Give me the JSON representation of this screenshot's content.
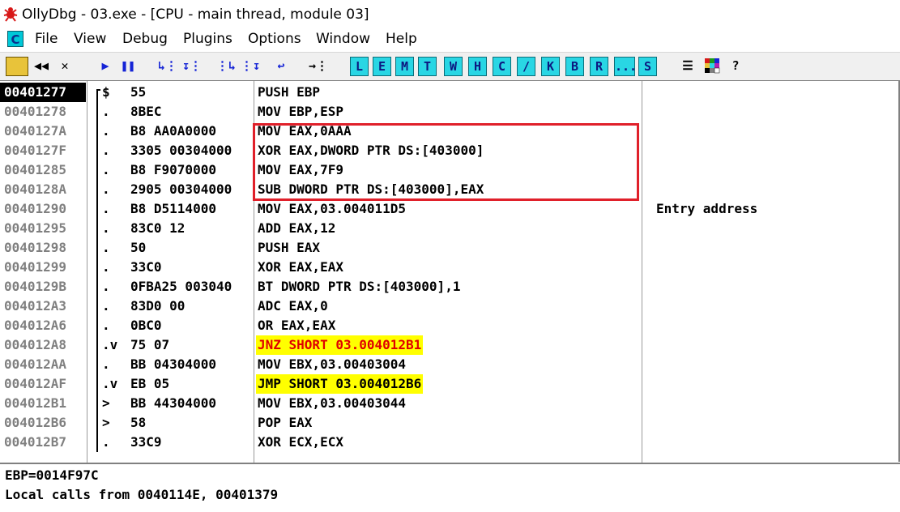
{
  "window": {
    "title": "OllyDbg - 03.exe - [CPU - main thread, module 03]"
  },
  "menu": {
    "sys_icon": "C",
    "items": [
      "File",
      "View",
      "Debug",
      "Plugins",
      "Options",
      "Window",
      "Help"
    ]
  },
  "toolbar": {
    "left_buttons": [
      "open-icon",
      "restart-icon",
      "close-icon",
      "run-icon",
      "pause-icon",
      "step-into-icon",
      "step-over-icon",
      "trace-into-icon",
      "trace-over-icon",
      "execute-till-return-icon",
      "go-to-icon"
    ],
    "letters": [
      "L",
      "E",
      "M",
      "T",
      "W",
      "H",
      "C",
      "/",
      "K",
      "B",
      "R",
      "...",
      "S"
    ],
    "right_buttons": [
      "list-icon",
      "colors-icon",
      "help-icon"
    ],
    "help_label": "?"
  },
  "disasm": {
    "rows": [
      {
        "addr": "00401277",
        "marker": "$",
        "hex": "55",
        "instr": "PUSH EBP",
        "comment": "",
        "current": true
      },
      {
        "addr": "00401278",
        "marker": ".",
        "hex": "8BEC",
        "instr": "MOV EBP,ESP",
        "comment": ""
      },
      {
        "addr": "0040127A",
        "marker": ".",
        "hex": "B8 AA0A0000",
        "instr": "MOV EAX,0AAA",
        "comment": ""
      },
      {
        "addr": "0040127F",
        "marker": ".",
        "hex": "3305 00304000",
        "instr": "XOR EAX,DWORD PTR DS:[403000]",
        "comment": ""
      },
      {
        "addr": "00401285",
        "marker": ".",
        "hex": "B8 F9070000",
        "instr": "MOV EAX,7F9",
        "comment": ""
      },
      {
        "addr": "0040128A",
        "marker": ".",
        "hex": "2905 00304000",
        "instr": "SUB DWORD PTR DS:[403000],EAX",
        "comment": ""
      },
      {
        "addr": "00401290",
        "marker": ".",
        "hex": "B8 D5114000",
        "instr": "MOV EAX,03.004011D5",
        "comment": "Entry address"
      },
      {
        "addr": "00401295",
        "marker": ".",
        "hex": "83C0 12",
        "instr": "ADD EAX,12",
        "comment": ""
      },
      {
        "addr": "00401298",
        "marker": ".",
        "hex": "50",
        "instr": "PUSH EAX",
        "comment": ""
      },
      {
        "addr": "00401299",
        "marker": ".",
        "hex": "33C0",
        "instr": "XOR EAX,EAX",
        "comment": ""
      },
      {
        "addr": "0040129B",
        "marker": ".",
        "hex": "0FBA25 003040",
        "instr": "BT DWORD PTR DS:[403000],1",
        "comment": ""
      },
      {
        "addr": "004012A3",
        "marker": ".",
        "hex": "83D0 00",
        "instr": "ADC EAX,0",
        "comment": ""
      },
      {
        "addr": "004012A6",
        "marker": ".",
        "hex": "0BC0",
        "instr": "OR EAX,EAX",
        "comment": ""
      },
      {
        "addr": "004012A8",
        "marker": ".v",
        "hex": "75 07",
        "instr": "JNZ SHORT 03.004012B1",
        "comment": "",
        "style": "jnz"
      },
      {
        "addr": "004012AA",
        "marker": ".",
        "hex": "BB 04304000",
        "instr": "MOV EBX,03.00403004",
        "comment": ""
      },
      {
        "addr": "004012AF",
        "marker": ".v",
        "hex": "EB 05",
        "instr": "JMP SHORT 03.004012B6",
        "comment": "",
        "style": "jmp"
      },
      {
        "addr": "004012B1",
        "marker": ">",
        "hex": "BB 44304000",
        "instr": "MOV EBX,03.00403044",
        "comment": ""
      },
      {
        "addr": "004012B6",
        "marker": ">",
        "hex": "58",
        "instr": "POP EAX",
        "comment": ""
      },
      {
        "addr": "004012B7",
        "marker": ".",
        "hex": "33C9",
        "instr": "XOR ECX,ECX",
        "comment": ""
      }
    ]
  },
  "info": {
    "line1": "EBP=0014F97C",
    "line2": "Local calls from 0040114E, 00401379"
  },
  "colors": {
    "highlight_box": "#e0202a",
    "jump_highlight": "#ffff00",
    "jnz_text": "#e00000",
    "letter_button": "#29d6e4"
  }
}
